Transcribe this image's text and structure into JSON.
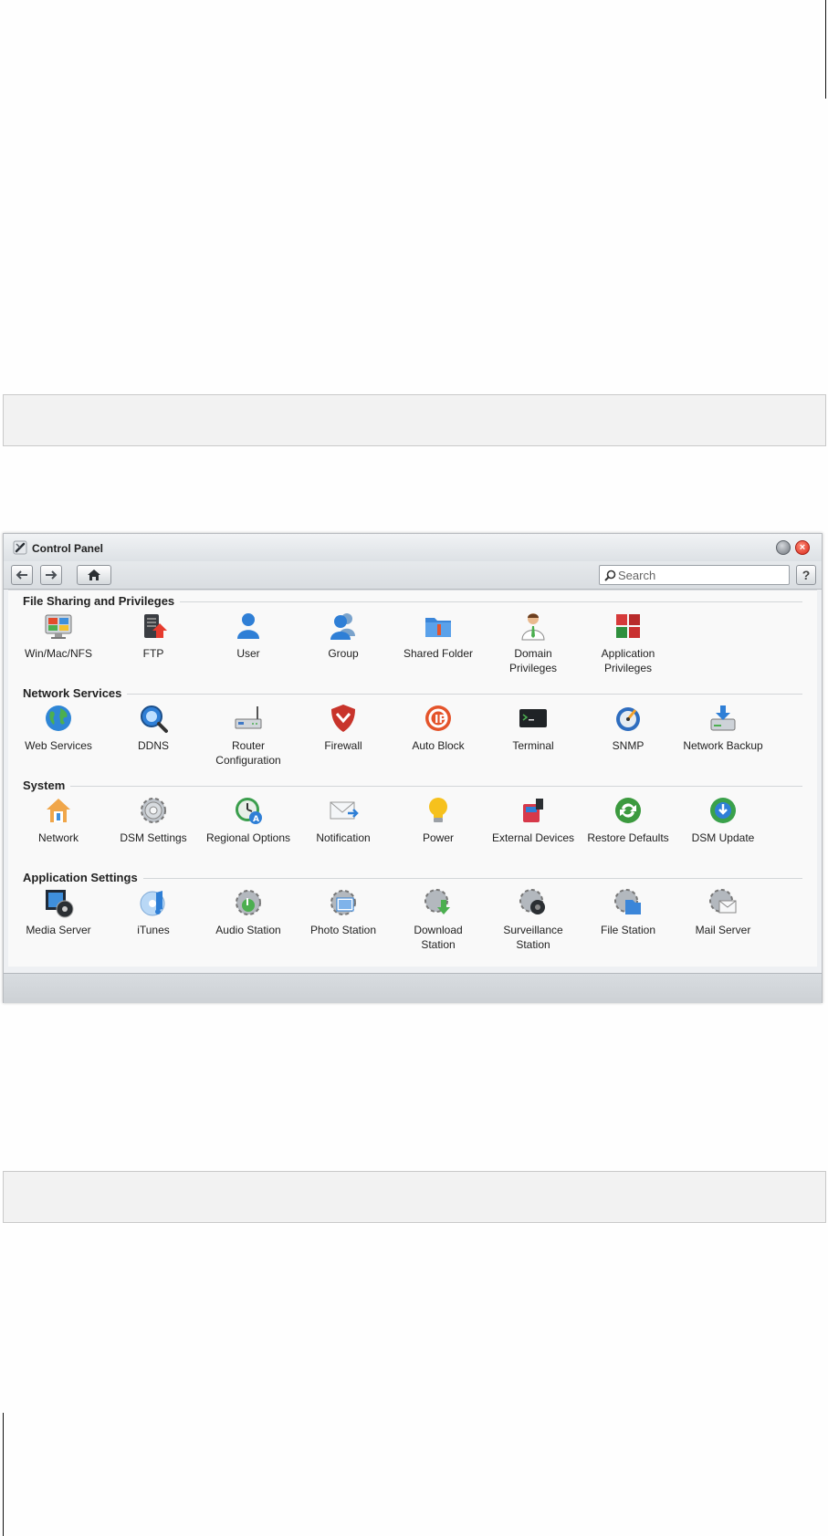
{
  "window": {
    "title": "Control Panel",
    "close_glyph": "×",
    "help_glyph": "?"
  },
  "search": {
    "placeholder": "Search"
  },
  "icons": {
    "back": "arrow-left-icon",
    "forward": "arrow-right-icon",
    "home": "house-icon",
    "search": "magnifier-icon"
  },
  "sections": [
    {
      "title": "File Sharing and Privileges",
      "items": [
        {
          "label": "Win/Mac/NFS",
          "icon": "monitor-icon"
        },
        {
          "label": "FTP",
          "icon": "ftp-server-icon"
        },
        {
          "label": "User",
          "icon": "user-icon"
        },
        {
          "label": "Group",
          "icon": "group-icon"
        },
        {
          "label": "Shared Folder",
          "icon": "shared-folder-icon"
        },
        {
          "label": "Domain\nPrivileges",
          "icon": "domain-user-icon"
        },
        {
          "label": "Application\nPrivileges",
          "icon": "cubes-icon"
        }
      ]
    },
    {
      "title": "Network Services",
      "items": [
        {
          "label": "Web Services",
          "icon": "globe-icon"
        },
        {
          "label": "DDNS",
          "icon": "ddns-magnifier-icon"
        },
        {
          "label": "Router\nConfiguration",
          "icon": "router-icon"
        },
        {
          "label": "Firewall",
          "icon": "shield-icon"
        },
        {
          "label": "Auto Block",
          "icon": "block-ip-icon"
        },
        {
          "label": "Terminal",
          "icon": "terminal-icon"
        },
        {
          "label": "SNMP",
          "icon": "snmp-dial-icon"
        },
        {
          "label": "Network Backup",
          "icon": "backup-drive-icon"
        }
      ]
    },
    {
      "title": "System",
      "items": [
        {
          "label": "Network",
          "icon": "network-house-icon"
        },
        {
          "label": "DSM Settings",
          "icon": "gear-icon"
        },
        {
          "label": "Regional Options",
          "icon": "clock-icon"
        },
        {
          "label": "Notification",
          "icon": "envelope-icon"
        },
        {
          "label": "Power",
          "icon": "light-bulb-icon"
        },
        {
          "label": "External Devices",
          "icon": "usb-device-icon"
        },
        {
          "label": "Restore Defaults",
          "icon": "refresh-arrows-icon"
        },
        {
          "label": "DSM Update",
          "icon": "update-icon"
        }
      ]
    },
    {
      "title": "Application Settings",
      "items": [
        {
          "label": "Media Server",
          "icon": "media-server-icon"
        },
        {
          "label": "iTunes",
          "icon": "itunes-icon"
        },
        {
          "label": "Audio Station",
          "icon": "audio-gear-icon"
        },
        {
          "label": "Photo Station",
          "icon": "photo-gear-icon"
        },
        {
          "label": "Download\nStation",
          "icon": "download-gear-icon"
        },
        {
          "label": "Surveillance\nStation",
          "icon": "camera-gear-icon"
        },
        {
          "label": "File Station",
          "icon": "file-gear-icon"
        },
        {
          "label": "Mail Server",
          "icon": "mail-gear-icon"
        }
      ]
    }
  ]
}
